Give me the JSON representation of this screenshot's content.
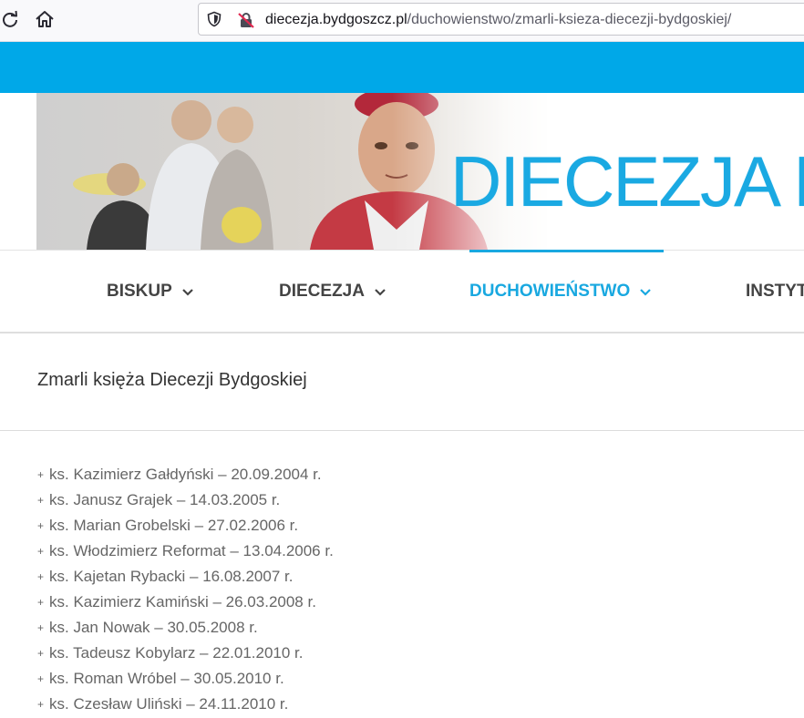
{
  "browser": {
    "url_domain": "diecezja.bydgoszcz.pl",
    "url_path": "/duchowienstwo/zmarli-ksieza-diecezji-bydgoskiej/"
  },
  "banner": {
    "title": "DIECEZJA BY"
  },
  "nav": {
    "items": [
      {
        "label": "BISKUP"
      },
      {
        "label": "DIECEZJA"
      },
      {
        "label": "DUCHOWIEŃSTWO",
        "active": true
      },
      {
        "label": "INSTYT"
      }
    ]
  },
  "page": {
    "title": "Zmarli księża Diecezji Bydgoskiej",
    "list_prefix": "+",
    "entries": [
      "ks. Kazimierz Gałdyński – 20.09.2004 r.",
      "ks. Janusz Grajek – 14.03.2005 r.",
      "ks. Marian Grobelski – 27.02.2006 r.",
      "ks. Włodzimierz Reformat – 13.04.2006 r.",
      "ks. Kajetan Rybacki – 16.08.2007 r.",
      "ks. Kazimierz Kamiński – 26.03.2008 r.",
      "ks. Jan Nowak – 30.05.2008 r.",
      "ks. Tadeusz Kobylarz – 22.01.2010 r.",
      "ks. Roman Wróbel – 30.05.2010 r.",
      "ks. Czesław Uliński – 24.11.2010 r."
    ]
  },
  "colors": {
    "accent": "#00a8e8",
    "nav_active": "#19a8e0",
    "nav_text": "#444444",
    "body_text": "#666666"
  }
}
